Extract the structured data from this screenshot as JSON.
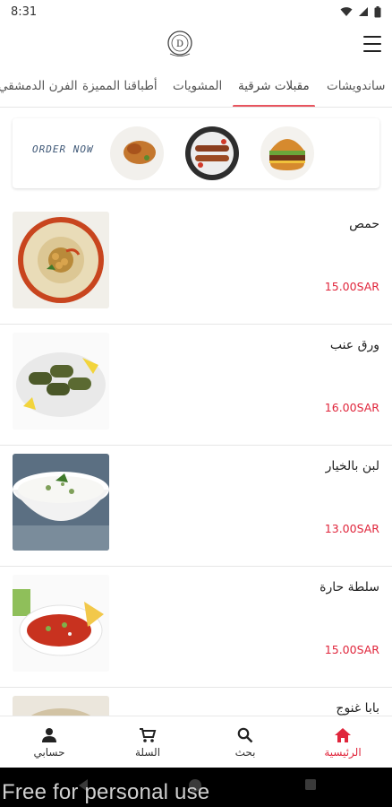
{
  "status_bar": {
    "time": "8:31"
  },
  "header": {
    "logo_icon": "restaurant-logo",
    "menu_icon": "hamburger-menu-icon"
  },
  "tabs": [
    {
      "label": "ساندويشات"
    },
    {
      "label": "مقبلات شرقية",
      "active": true
    },
    {
      "label": "المشويات"
    },
    {
      "label": "أطباقنا المميزة"
    },
    {
      "label": "الفرن الدمشقي"
    }
  ],
  "banner": {
    "text": "ORDER NOW"
  },
  "items": [
    {
      "name": "حمص",
      "price": "15.00SAR"
    },
    {
      "name": "ورق عنب",
      "price": "16.00SAR"
    },
    {
      "name": "لبن بالخيار",
      "price": "13.00SAR"
    },
    {
      "name": "سلطة حارة",
      "price": "15.00SAR"
    },
    {
      "name": "بابا غنوج",
      "price": ""
    }
  ],
  "bottom_nav": {
    "home": "الرئيسية",
    "search": "بحث",
    "cart": "السلة",
    "account": "حسابي"
  },
  "colors": {
    "accent": "#e0263c",
    "tab_indicator": "#e8555f"
  },
  "watermark": "Free for personal use"
}
